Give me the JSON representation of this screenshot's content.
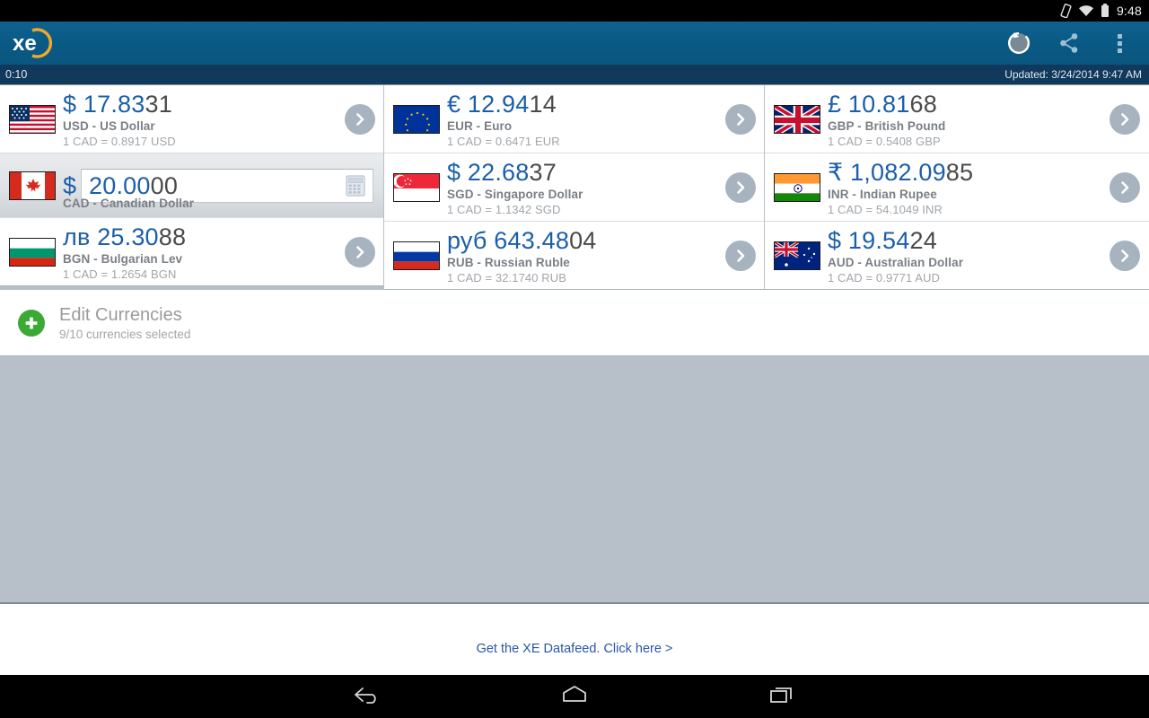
{
  "status_bar": {
    "icons": [
      "vibrate-icon",
      "wifi-icon",
      "battery-icon"
    ],
    "time": "9:48"
  },
  "app_bar": {
    "logo_text": "xe",
    "actions": [
      {
        "name": "refresh-button",
        "label": "Refresh"
      },
      {
        "name": "share-button",
        "label": "Share"
      },
      {
        "name": "overflow-menu-button",
        "label": "More options"
      }
    ]
  },
  "sub_bar": {
    "timer": "0:10",
    "updated_label": "Updated:  3/24/2014 9:47 AM"
  },
  "base_currency": {
    "flag": "flag-ca",
    "symbol": "$",
    "value_head": "20.00",
    "value_tail": "00",
    "full_value": "20.0000",
    "label": "CAD - Canadian Dollar",
    "calculator_icon": "calculator-icon"
  },
  "columns": [
    {
      "rows": [
        {
          "flag": "flag-us",
          "symbol": "$",
          "amount_head": "17.83",
          "amount_tail": "31",
          "name": "USD - US Dollar",
          "rate": "1 CAD = 0.8917 USD"
        },
        {
          "flag": "flag-bg",
          "symbol": "лв",
          "amount_head": "25.30",
          "amount_tail": "88",
          "name": "BGN - Bulgarian Lev",
          "rate": "1 CAD = 1.2654 BGN"
        }
      ]
    },
    {
      "rows": [
        {
          "flag": "flag-eu",
          "symbol": "€",
          "amount_head": "12.94",
          "amount_tail": "14",
          "name": "EUR - Euro",
          "rate": "1 CAD = 0.6471 EUR"
        },
        {
          "flag": "flag-sg",
          "symbol": "$",
          "amount_head": "22.68",
          "amount_tail": "37",
          "name": "SGD - Singapore Dollar",
          "rate": "1 CAD = 1.1342 SGD"
        },
        {
          "flag": "flag-ru",
          "symbol": "руб",
          "amount_head": "643.48",
          "amount_tail": "04",
          "name": "RUB - Russian Ruble",
          "rate": "1 CAD = 32.1740 RUB"
        }
      ]
    },
    {
      "rows": [
        {
          "flag": "flag-gb",
          "symbol": "£",
          "amount_head": "10.81",
          "amount_tail": "68",
          "name": "GBP - British Pound",
          "rate": "1 CAD = 0.5408 GBP"
        },
        {
          "flag": "flag-in",
          "symbol": "₹",
          "amount_head": "1,082.09",
          "amount_tail": "85",
          "name": "INR - Indian Rupee",
          "rate": "1 CAD = 54.1049 INR"
        },
        {
          "flag": "flag-au",
          "symbol": "$",
          "amount_head": "19.54",
          "amount_tail": "24",
          "name": "AUD - Australian Dollar",
          "rate": "1 CAD = 0.9771 AUD"
        }
      ]
    }
  ],
  "edit_currencies": {
    "title": "Edit Currencies",
    "subtitle": "9/10 currencies selected",
    "icon": "plus-circle-icon"
  },
  "footer": {
    "link_text": "Get the XE Datafeed. Click here >"
  },
  "nav_bar": {
    "buttons": [
      "back-icon",
      "home-icon",
      "recents-icon"
    ]
  },
  "colors": {
    "accent_blue": "#1b5faa",
    "appbar_blue": "#0a5a86",
    "subbar_blue": "#11395c",
    "page_bg": "#b7c0c8",
    "green": "#3aaa35"
  }
}
